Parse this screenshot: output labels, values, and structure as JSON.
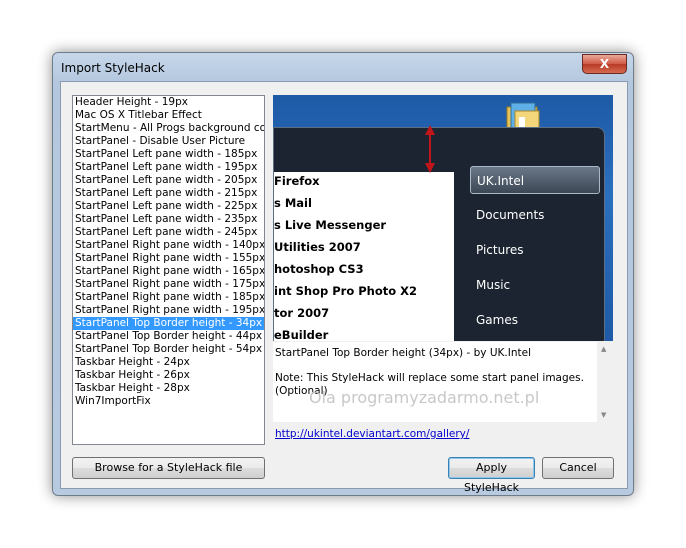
{
  "window": {
    "title": "Import StyleHack",
    "close_glyph": "X"
  },
  "list": {
    "selected_index": 17,
    "items": [
      "Header Height - 19px",
      "Mac OS X Titlebar Effect",
      "StartMenu - All Progs background color",
      "StartPanel - Disable User Picture",
      "StartPanel Left pane width - 185px",
      "StartPanel Left pane width - 195px",
      "StartPanel Left pane width - 205px",
      "StartPanel Left pane width - 215px",
      "StartPanel Left pane width - 225px",
      "StartPanel Left pane width - 235px",
      "StartPanel Left pane width - 245px",
      "StartPanel Right pane width - 140px",
      "StartPanel Right pane width - 155px",
      "StartPanel Right pane width - 165px",
      "StartPanel Right pane width - 175px",
      "StartPanel Right pane width - 185px",
      "StartPanel Right pane width - 195px",
      "StartPanel Top Border height - 34px",
      "StartPanel Top Border height - 44px",
      "StartPanel Top Border height - 54px",
      "Taskbar Height - 24px",
      "Taskbar Height - 26px",
      "Taskbar Height - 28px",
      "Win7ImportFix"
    ]
  },
  "preview": {
    "programs": [
      "Firefox",
      "s Mail",
      "s Live Messenger",
      "Utilities 2007",
      "hotoshop CS3",
      "int Shop Pro Photo X2",
      "tor 2007",
      "eBuilder"
    ],
    "right_items": [
      "UK.Intel",
      "Documents",
      "Pictures",
      "Music",
      "Games"
    ],
    "folder_icon": "folder-icon",
    "arrow_icon": "resize-arrow-icon",
    "arrow_color": "#c0161b"
  },
  "description": {
    "line1": "StartPanel Top Border height  (34px) - by UK.Intel",
    "line2": "Note: This StyleHack will replace some start panel images.",
    "line3": "(Optional)"
  },
  "watermark": "Ola programyzadarmo.net.pl",
  "link": "http://ukintel.deviantart.com/gallery/",
  "buttons": {
    "browse": "Browse for a StyleHack file",
    "apply": "Apply StyleHack",
    "cancel": "Cancel"
  }
}
